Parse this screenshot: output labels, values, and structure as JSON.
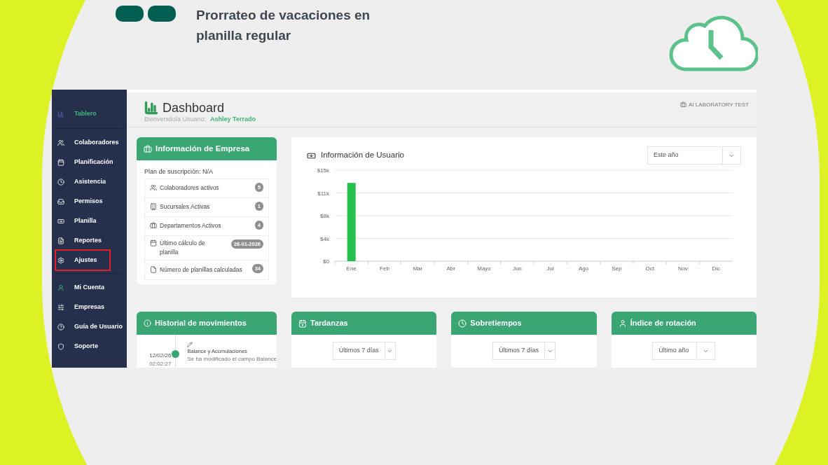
{
  "slide": {
    "title": "Prorrateo de vacaciones en planilla regular"
  },
  "sidebar": {
    "groups": [
      [
        {
          "label": "Tablero",
          "selected": true,
          "highlighted": false
        }
      ],
      [
        {
          "label": "Colaboradores",
          "selected": false,
          "highlighted": false
        },
        {
          "label": "Planificación",
          "selected": false,
          "highlighted": false
        },
        {
          "label": "Asistencia",
          "selected": false,
          "highlighted": false
        },
        {
          "label": "Permisos",
          "selected": false,
          "highlighted": false
        },
        {
          "label": "Planilla",
          "selected": false,
          "highlighted": false
        },
        {
          "label": "Reportes",
          "selected": false,
          "highlighted": false
        },
        {
          "label": "Ajustes",
          "selected": false,
          "highlighted": true
        }
      ],
      [
        {
          "label": "Mi Cuenta",
          "selected": false,
          "highlighted": false
        },
        {
          "label": "Empresas",
          "selected": false,
          "highlighted": false
        },
        {
          "label": "Guía de Usuario",
          "selected": false,
          "highlighted": false
        },
        {
          "label": "Soporte",
          "selected": false,
          "highlighted": false
        }
      ]
    ]
  },
  "header": {
    "title": "Dashboard",
    "welcome": "Bienvenido/a Usuario:",
    "user": "Ashley Terrado",
    "company": "AI LABORATORY TEST"
  },
  "company_card": {
    "title": "Información de Empresa",
    "plan": "Plan de suscripción: N/A",
    "rows": [
      {
        "label": "Colaboradores activos",
        "badge": "5"
      },
      {
        "label": "Sucursales Activas",
        "badge": "1"
      },
      {
        "label": "Departamentos Activos",
        "badge": "4"
      },
      {
        "label": "Último cálculo de planilla",
        "badge": "28-01-2026"
      },
      {
        "label": "Número de planillas calculadas",
        "badge": "34"
      }
    ]
  },
  "user_card": {
    "title": "Información de Usuario",
    "period": "Este año",
    "chart_data": {
      "type": "bar",
      "grid": true,
      "categories": [
        "Ene",
        "Feb",
        "Mar",
        "Abr",
        "Mayo",
        "Jun",
        "Jul",
        "Ago",
        "Sep",
        "Oct",
        "Nov",
        "Dic"
      ],
      "values": [
        12900,
        0,
        0,
        0,
        0,
        0,
        0,
        0,
        0,
        0,
        0,
        0
      ],
      "ylim": [
        0,
        15000
      ],
      "yticks": [
        {
          "value": 0,
          "label": "$0"
        },
        {
          "value": 3750,
          "label": "$4k"
        },
        {
          "value": 7500,
          "label": "$8k"
        },
        {
          "value": 11250,
          "label": "$11k"
        },
        {
          "value": 15000,
          "label": "$15k"
        }
      ]
    }
  },
  "history": {
    "title": "Historial de movimientos",
    "entries": [
      {
        "date": "12/02/26",
        "time": "02:02:27",
        "title": "Balance y Acumulaciones",
        "text": "Se ha modificado el campo Balance"
      }
    ]
  },
  "widgets": [
    {
      "title": "Tardanzas",
      "period": "Últimos 7 días"
    },
    {
      "title": "Sobretiempos",
      "period": "Últimos 7 días"
    },
    {
      "title": "Índice de rotación",
      "period": "Último año"
    }
  ]
}
